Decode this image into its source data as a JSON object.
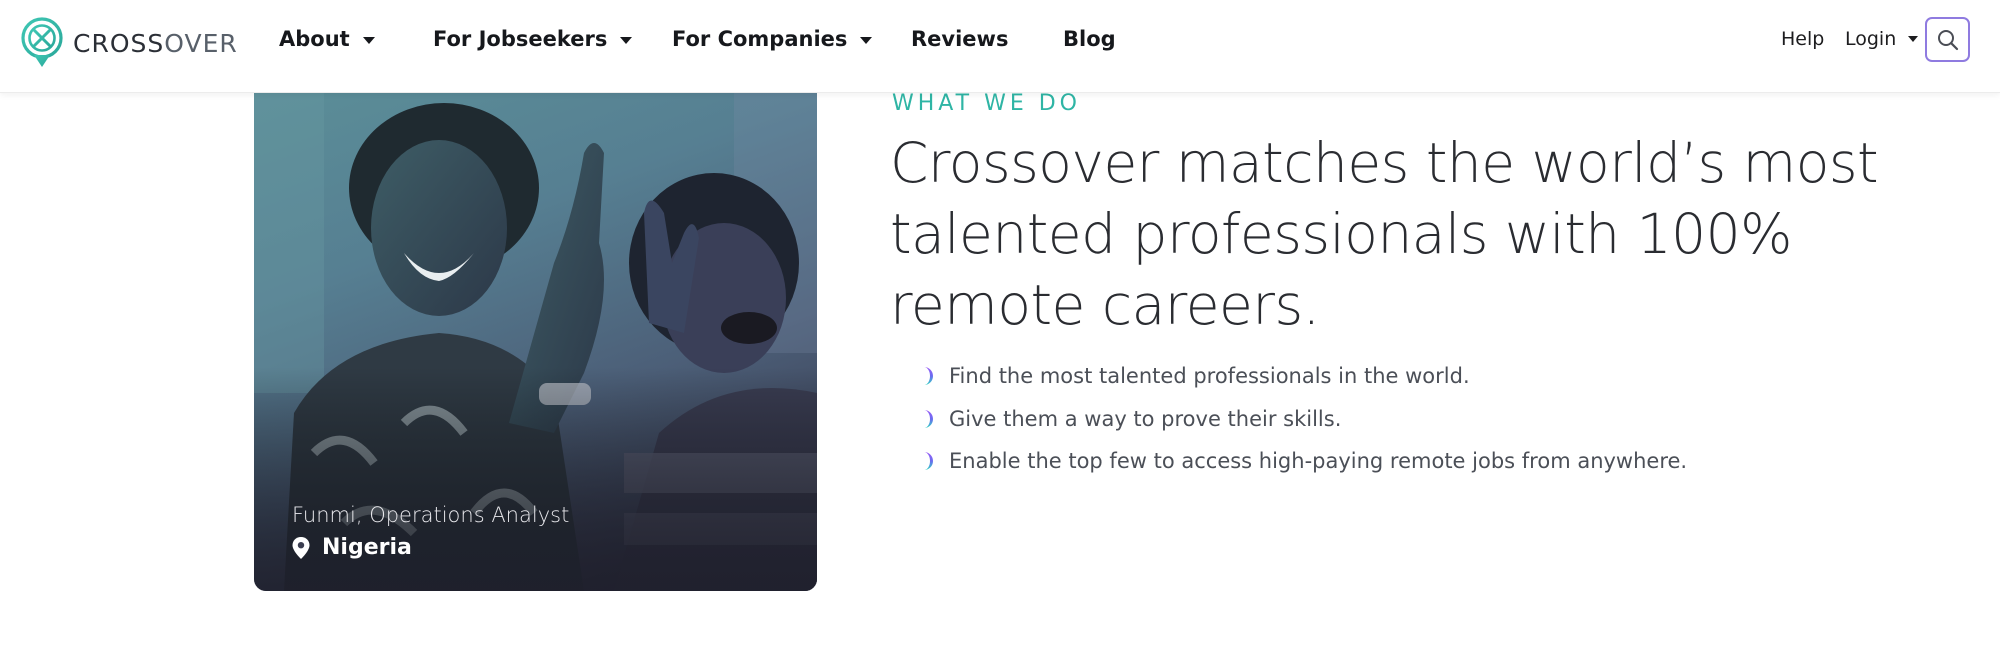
{
  "brand": {
    "part1": "CROSS",
    "part2": "OVER",
    "primary_color": "#2fb5a5",
    "accent_color": "#8f7be0"
  },
  "nav": {
    "about": "About",
    "jobseekers": "For Jobseekers",
    "companies": "For Companies",
    "reviews": "Reviews",
    "blog": "Blog"
  },
  "nav_right": {
    "help": "Help",
    "login": "Login",
    "search_icon": "search-icon"
  },
  "photo": {
    "person": "Funmi, Operations Analyst",
    "location": "Nigeria",
    "location_icon": "map-pin-icon"
  },
  "section": {
    "eyebrow": "WHAT WE DO",
    "headline": "Crossover matches the world’s most talented professionals with 100% remote careers.",
    "bullets": [
      "Find the most talented professionals in the world.",
      "Give them a way to prove their skills.",
      "Enable the top few to access high-paying remote jobs from anywhere."
    ],
    "bullet_icon": "gradient-crescent-icon"
  }
}
